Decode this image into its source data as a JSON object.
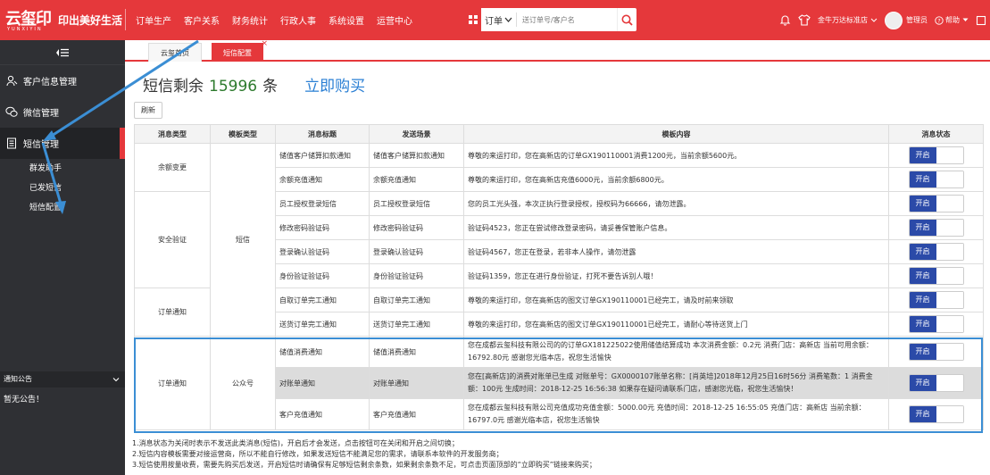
{
  "brand": {
    "logo_text": "云玺印",
    "logo_sub": "YUNXIYIN",
    "slogan": "印出美好生活"
  },
  "nav": {
    "items": [
      "订单生产",
      "客户关系",
      "财务统计",
      "行政人事",
      "系统设置",
      "运营中心"
    ]
  },
  "search": {
    "type_label": "订单",
    "placeholder": "送订单号/客户名"
  },
  "header": {
    "store": "金牛万达标准店",
    "user": "管理员",
    "help": "帮助"
  },
  "sidebar": {
    "items": [
      {
        "label": "客户信息管理"
      },
      {
        "label": "微信管理"
      },
      {
        "label": "短信管理"
      }
    ],
    "sub_items": [
      "群发助手",
      "已发短信",
      "短信配置"
    ]
  },
  "notice": {
    "title": "通知公告",
    "body": "暂无公告！"
  },
  "tabs": [
    {
      "label": "云玺首页"
    },
    {
      "label": "短信配置"
    }
  ],
  "balance": {
    "label": "短信剩余",
    "count": "15996",
    "unit": "条",
    "buy": "立即购买"
  },
  "refresh_label": "刷新",
  "table": {
    "headers": [
      "消息类型",
      "模板类型",
      "消息标题",
      "发送场景",
      "模板内容",
      "消息状态"
    ],
    "groups": [
      {
        "type": "余额变更",
        "template": "短信"
      },
      {
        "type": "安全验证"
      },
      {
        "type": "订单通知"
      },
      {
        "type": "订单通知",
        "template": "公众号"
      }
    ],
    "rows": [
      {
        "title": "储值客户储算扣款通知",
        "scene": "储值客户储算扣款通知",
        "content": "尊敬的来运打印，您在高新店的订单GX190110001消费1200元，当前余额5600元。",
        "status": "开启"
      },
      {
        "title": "余额充值通知",
        "scene": "余额充值通知",
        "content": "尊敬的来运打印，您在高新店充值6000元，当前余额6800元。",
        "status": "开启"
      },
      {
        "title": "员工授权登录短信",
        "scene": "员工授权登录短信",
        "content": "您的员工光头强，本次正执行登录授权，授权码为66666，请勿泄露。",
        "status": "开启"
      },
      {
        "title": "修改密码验证码",
        "scene": "修改密码验证码",
        "content": "验证码4523，您正在尝试修改登录密码，请妥善保管账户信息。",
        "status": "开启"
      },
      {
        "title": "登录确认验证码",
        "scene": "登录确认验证码",
        "content": "验证码4567，您正在登录，若非本人操作，请勿泄露",
        "status": "开启"
      },
      {
        "title": "身份验证验证码",
        "scene": "身份验证验证码",
        "content": "验证码1359，您正在进行身份验证，打死不要告诉别人哦！",
        "status": "开启"
      },
      {
        "title": "自取订单完工通知",
        "scene": "自取订单完工通知",
        "content": "尊敬的来运打印，您在高新店的图文订单GX190110001已经完工，请及时前来领取",
        "status": "开启"
      },
      {
        "title": "送货订单完工通知",
        "scene": "送货订单完工通知",
        "content": "尊敬的来运打印，您在高新店的图文订单GX190110001已经完工，请耐心等待送货上门",
        "status": "开启"
      },
      {
        "title": "储值消费通知",
        "scene": "储值消费通知",
        "content": "您在成都云玺科技有限公司的的订单GX181225022使用储值结算成功 本次消费金额：0.2元 消费门店：高新店 当前可用余额：16792.80元 感谢您光临本店，祝您生活愉快",
        "status": "开启"
      },
      {
        "title": "对账单通知",
        "scene": "对账单通知",
        "content": "您在[高新店]的消费对账单已生成 对账单号：GX0000107账单名称：[肖英培]2018年12月25日16时56分 消费笔数：1 消费金额：100元 生成时间：2018-12-25 16:56:38 如果存在疑问请联系门店，感谢您光临，祝您生活愉快！",
        "status": "开启"
      },
      {
        "title": "客户充值通知",
        "scene": "客户充值通知",
        "content": "您在成都云玺科技有限公司充值成功充值金额：5000.00元 充值时间：2018-12-25 16:55:05 充值门店：高新店 当前余额：16797.0元 感谢光临本店，祝您生活愉快",
        "status": "开启"
      }
    ]
  },
  "notes": [
    "1.消息状态为关闭时表示不发送此类消息(短信)，开启后才会发送，点击按钮可在关闭和开启之间切换；",
    "2.短信内容模板需要对接运营商，所以不能自行修改，如果发送短信不能满足您的需求，请联系本软件的开发服务商；",
    "3.短信使用按量收费，需要先购买后发送，开启短信时请确保有足够短信剩余条数，如果剩余条数不足，可点击页面顶部的“立即购买”链接来购买；"
  ],
  "colors": {
    "brand_red": "#e5383b",
    "toggle_blue": "#2b4aa8",
    "highlight_blue": "#3b8ed4",
    "count_green": "#2d7a2d",
    "link_blue": "#2a7fd4"
  }
}
